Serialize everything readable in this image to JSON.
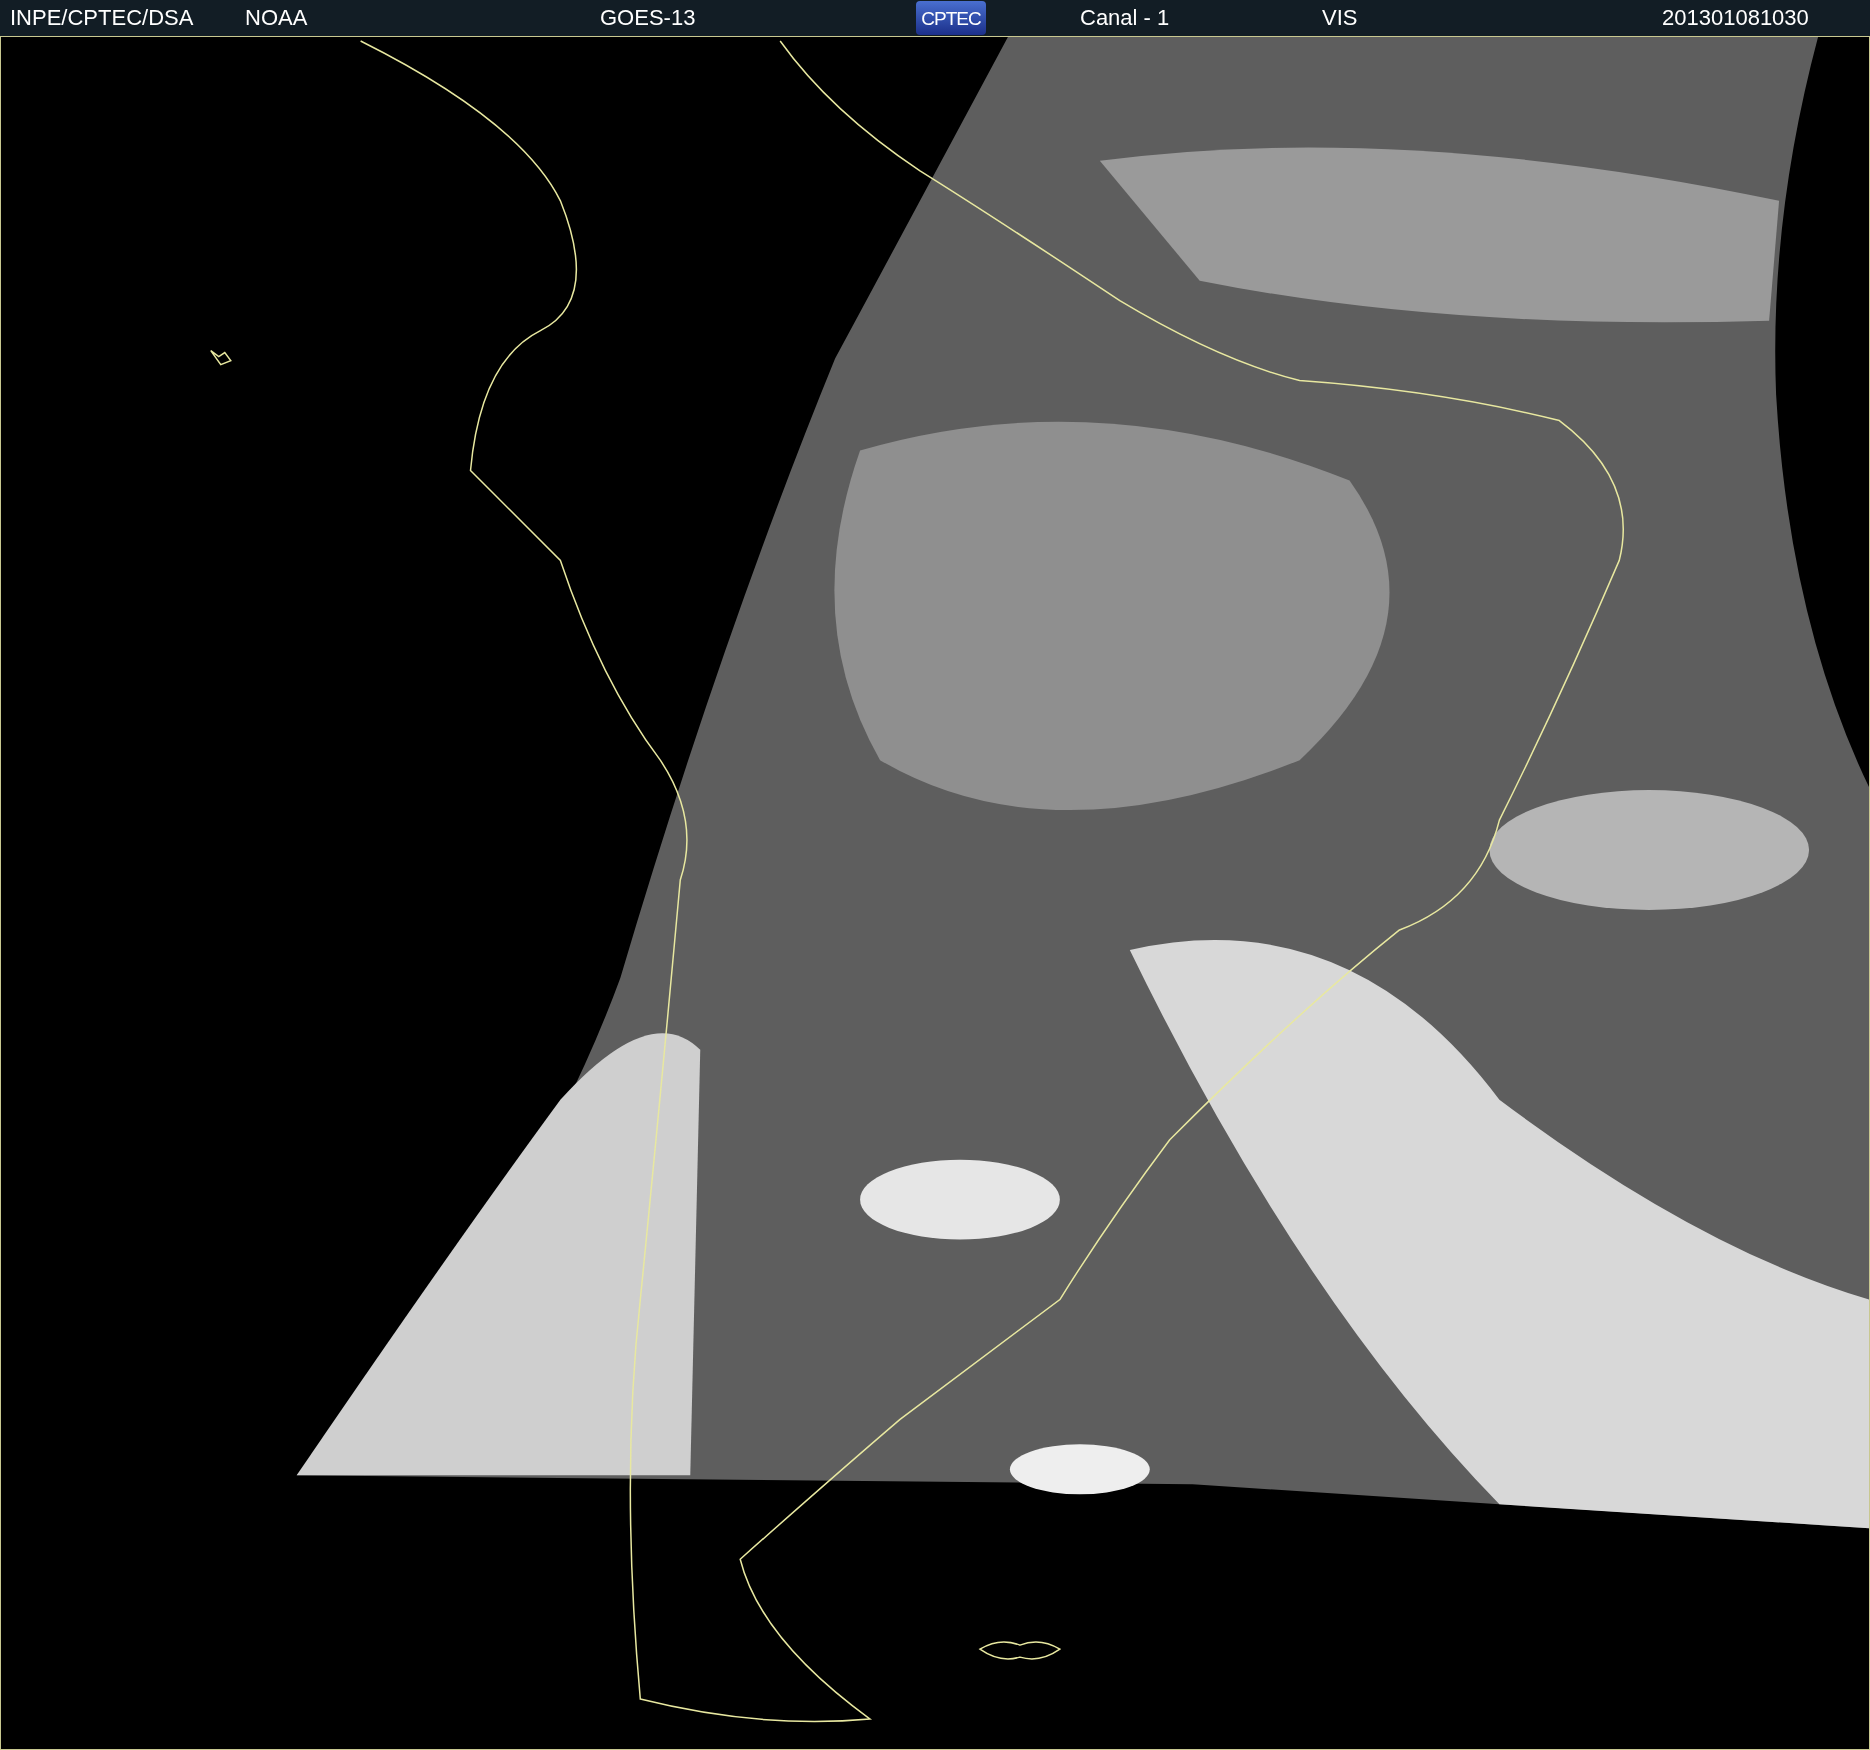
{
  "header": {
    "left": [
      "INPE/CPTEC/DSA",
      "NOAA"
    ],
    "satellite": "GOES-13",
    "logo": "CPTEC",
    "channel": "Canal - 1",
    "band": "VIS",
    "timestamp": "201301081030"
  }
}
